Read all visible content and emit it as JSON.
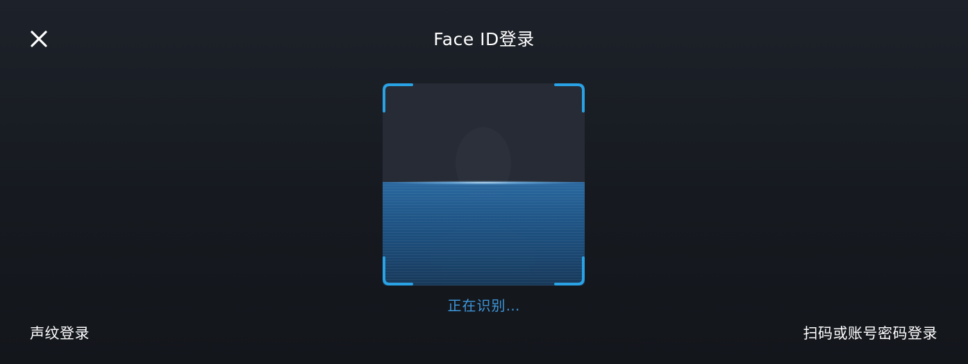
{
  "header": {
    "title": "Face ID登录",
    "close_icon": "close-icon"
  },
  "scanner": {
    "status_text": "正在识别…",
    "frame_color": "#29a3e6",
    "scan_color": "#2b6ea9",
    "status_color": "#3e96da"
  },
  "footer": {
    "voice_login_label": "声纹登录",
    "qr_login_label": "扫码或账号密码登录"
  }
}
